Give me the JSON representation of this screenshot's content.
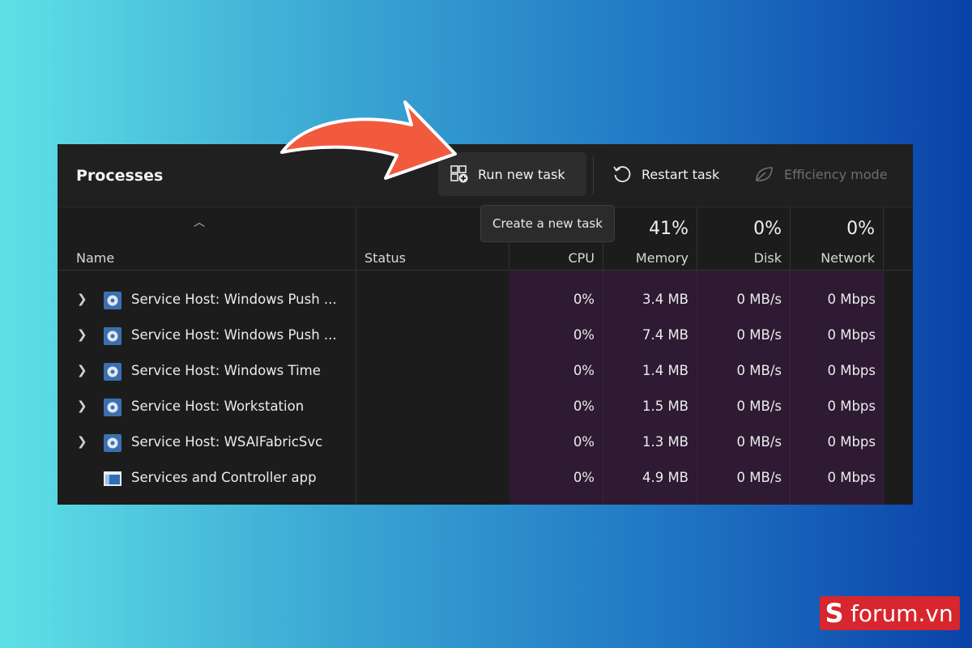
{
  "toolbar": {
    "title": "Processes",
    "run_new_task": "Run new task",
    "restart_task": "Restart task",
    "efficiency_mode": "Efficiency mode",
    "tooltip": "Create a new task"
  },
  "header": {
    "name": "Name",
    "status": "Status",
    "cpu": "CPU",
    "memory": "Memory",
    "memory_pct": "41%",
    "disk": "Disk",
    "disk_pct": "0%",
    "network": "Network",
    "network_pct": "0%"
  },
  "rows": [
    {
      "name": "Service Host: Windows Push ...",
      "cpu": "0%",
      "memory": "3.4 MB",
      "disk": "0 MB/s",
      "network": "0 Mbps",
      "expandable": true
    },
    {
      "name": "Service Host: Windows Push ...",
      "cpu": "0%",
      "memory": "7.4 MB",
      "disk": "0 MB/s",
      "network": "0 Mbps",
      "expandable": true
    },
    {
      "name": "Service Host: Windows Time",
      "cpu": "0%",
      "memory": "1.4 MB",
      "disk": "0 MB/s",
      "network": "0 Mbps",
      "expandable": true
    },
    {
      "name": "Service Host: Workstation",
      "cpu": "0%",
      "memory": "1.5 MB",
      "disk": "0 MB/s",
      "network": "0 Mbps",
      "expandable": true
    },
    {
      "name": "Service Host: WSAIFabricSvc",
      "cpu": "0%",
      "memory": "1.3 MB",
      "disk": "0 MB/s",
      "network": "0 Mbps",
      "expandable": true
    },
    {
      "name": "Services and Controller app",
      "cpu": "0%",
      "memory": "4.9 MB",
      "disk": "0 MB/s",
      "network": "0 Mbps",
      "expandable": false
    }
  ],
  "colors": {
    "accent_arrow": "#f25a3e",
    "heat_column": "#2e1a33",
    "logo_red": "#d7262e"
  },
  "logo": {
    "letter": "S",
    "text": "forum.vn"
  }
}
